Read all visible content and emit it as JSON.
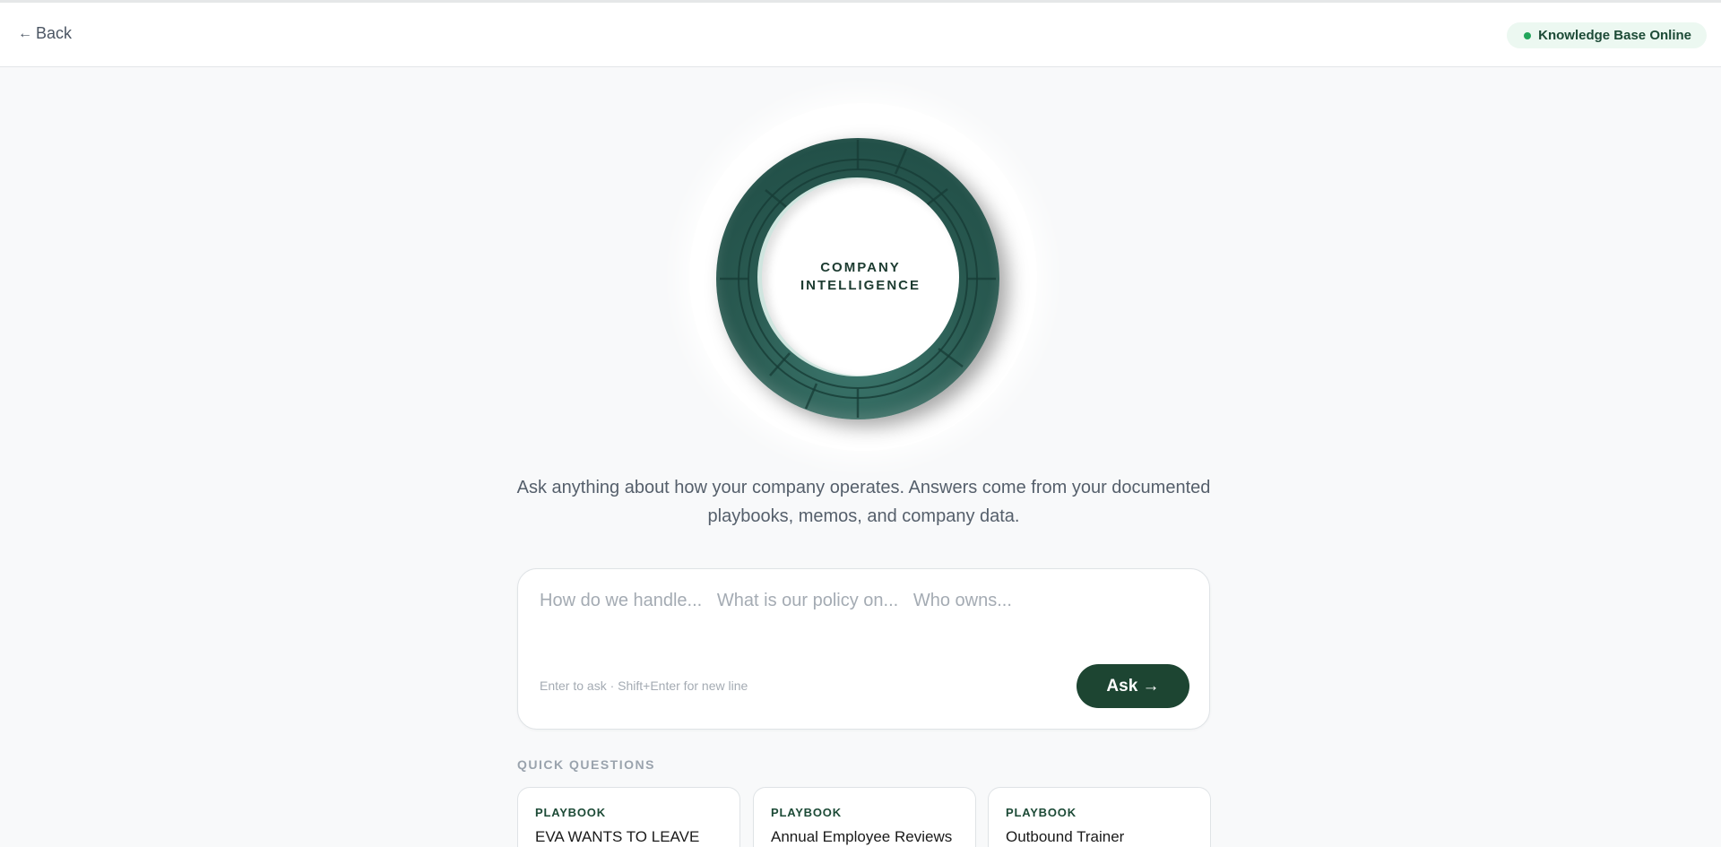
{
  "header": {
    "back_label": "Back",
    "status_label": "Knowledge Base Online",
    "status_color": "#22a55b"
  },
  "hero": {
    "line1": "COMPANY",
    "line2": "INTELLIGENCE",
    "accent": "#2a5b52"
  },
  "intro": {
    "text": "Ask anything about how your company operates. Answers come from your documented playbooks, memos, and company data."
  },
  "ask": {
    "placeholder": "How do we handle...   What is our policy on...   Who owns...",
    "value": "",
    "hint": "Enter to ask · Shift+Enter for new line",
    "button_label": "Ask →",
    "button_color": "#1d4532"
  },
  "quick": {
    "title": "QUICK QUESTIONS",
    "cards": [
      {
        "tag": "PLAYBOOK",
        "title": "EVA WANTS TO LEAVE"
      },
      {
        "tag": "PLAYBOOK",
        "title": "Annual Employee Reviews"
      },
      {
        "tag": "PLAYBOOK",
        "title": "Outbound Trainer"
      }
    ]
  }
}
